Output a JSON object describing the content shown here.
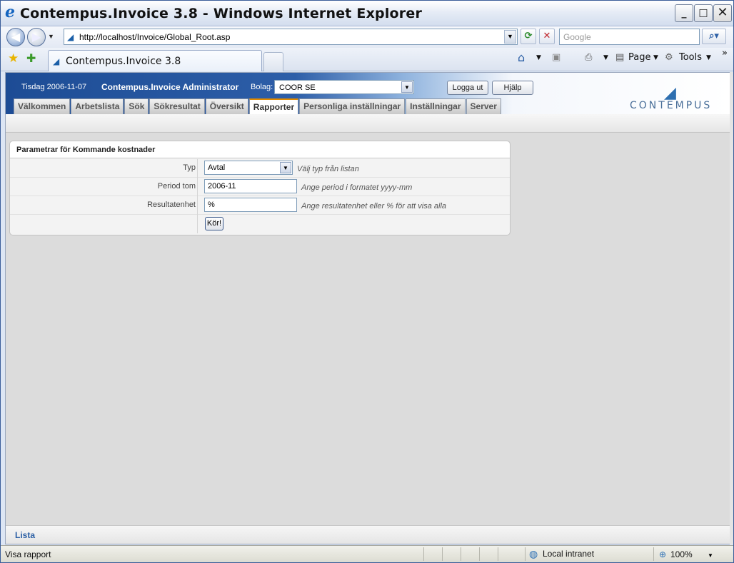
{
  "window": {
    "title": "Contempus.Invoice 3.8 - Windows Internet Explorer",
    "minimize": "_",
    "maximize": "□",
    "close": "✕"
  },
  "browser": {
    "url": "http://localhost/Invoice/Global_Root.asp",
    "search_placeholder": "Google",
    "tab_title": "Contempus.Invoice 3.8",
    "page_menu": "Page",
    "tools_menu": "Tools",
    "status_text": "Visa rapport",
    "zone": "Local intranet",
    "zoom": "100%"
  },
  "app": {
    "date": "Tisdag 2006-11-07",
    "user": "Contempus.Invoice Administrator",
    "bolag_label": "Bolag:",
    "bolag_value": "COOR SE",
    "logout": "Logga ut",
    "help": "Hjälp",
    "logo_text": "CONTEMPUS",
    "tabs": [
      {
        "label": "Välkommen",
        "active": false
      },
      {
        "label": "Arbetslista",
        "active": false
      },
      {
        "label": "Sök",
        "active": false
      },
      {
        "label": "Sökresultat",
        "active": false
      },
      {
        "label": "Översikt",
        "active": false
      },
      {
        "label": "Rapporter",
        "active": true
      },
      {
        "label": "Personliga inställningar",
        "active": false
      },
      {
        "label": "Inställningar",
        "active": false
      },
      {
        "label": "Server",
        "active": false
      }
    ]
  },
  "panel": {
    "title": "Parametrar för Kommande kostnader",
    "typ_label": "Typ",
    "typ_value": "Avtal",
    "typ_hint": "Välj typ från listan",
    "period_label": "Period tom",
    "period_value": "2006-11",
    "period_hint": "Ange period i formatet yyyy-mm",
    "result_label": "Resultatenhet",
    "result_value": "%",
    "result_hint": "Ange resultatenhet eller % för att visa alla",
    "run_button": "Kör!"
  },
  "footer": {
    "lista": "Lista"
  },
  "colors": {
    "header_blue": "#1d4c95",
    "active_tab_accent": "#e08a00",
    "link_blue": "#2b5fa5"
  },
  "icons": [
    "ie-logo-icon",
    "back-icon",
    "forward-icon",
    "refresh-icon",
    "stop-icon",
    "search-icon",
    "favorites-star-icon",
    "add-favorites-icon",
    "home-icon",
    "feeds-icon",
    "print-icon",
    "page-icon",
    "tools-gear-icon",
    "globe-icon",
    "zoom-icon"
  ]
}
